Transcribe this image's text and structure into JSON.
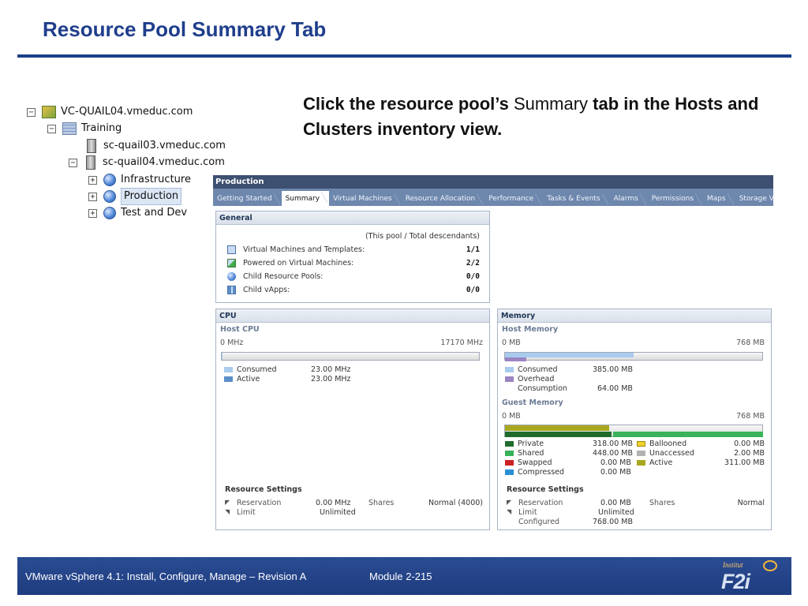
{
  "slide": {
    "title": "Resource Pool Summary Tab",
    "instruction": {
      "part1": "Click the resource pool’s ",
      "part2": "Summary",
      "part3": " tab in the Hosts and Clusters inventory view."
    },
    "footer": {
      "course": "VMware vSphere 4.1: Install, Configure, Manage – Revision A",
      "module": "Module 2-215"
    },
    "logo": {
      "small_text": "Institut",
      "big_text": "F2i"
    }
  },
  "tree": {
    "items": [
      {
        "label": "VC-QUAIL04.vmeduc.com",
        "expander": "−",
        "icon": "vcenter-icon"
      },
      {
        "label": "Training",
        "expander": "−",
        "icon": "datacenter-icon"
      },
      {
        "label": "sc-quail03.vmeduc.com",
        "expander": "",
        "icon": "host-icon"
      },
      {
        "label": "sc-quail04.vmeduc.com",
        "expander": "−",
        "icon": "host-icon"
      },
      {
        "label": "Infrastructure",
        "expander": "+",
        "icon": "resource-pool-icon"
      },
      {
        "label": "Production",
        "expander": "+",
        "icon": "resource-pool-icon",
        "selected": true
      },
      {
        "label": "Test and Dev",
        "expander": "+",
        "icon": "resource-pool-icon"
      }
    ]
  },
  "panel": {
    "title": "Production",
    "tabs": [
      "Getting Started",
      "Summary",
      "Virtual Machines",
      "Resource Allocation",
      "Performance",
      "Tasks & Events",
      "Alarms",
      "Permissions",
      "Maps",
      "Storage Views"
    ],
    "active_tab": "Summary",
    "general": {
      "heading": "General",
      "note": "(This pool / Total descendants)",
      "rows": [
        {
          "label": "Virtual Machines and Templates:",
          "value": "1/1",
          "icon": "vm-template-icon"
        },
        {
          "label": "Powered on Virtual Machines:",
          "value": "2/2",
          "icon": "powered-on-vm-icon"
        },
        {
          "label": "Child Resource Pools:",
          "value": "0/0",
          "icon": "resource-pool-icon"
        },
        {
          "label": "Child vApps:",
          "value": "0/0",
          "icon": "vapp-icon"
        }
      ]
    },
    "cpu": {
      "heading": "CPU",
      "subheading": "Host CPU",
      "min_label": "0 MHz",
      "max_label": "17170 MHz",
      "consumed_fraction": 0.0013,
      "legend": [
        {
          "label": "Consumed",
          "value": "23.00 MHz",
          "color": "#a9cbee"
        },
        {
          "label": "Active",
          "value": "23.00 MHz",
          "color": "#5b8fc9"
        }
      ],
      "settings": {
        "heading": "Resource Settings",
        "reservation_label": "Reservation",
        "reservation_value": "0.00 MHz",
        "limit_label": "Limit",
        "limit_value": "Unlimited",
        "shares_label": "Shares",
        "shares_value": "Normal (4000)"
      }
    },
    "memory": {
      "heading": "Memory",
      "host_subheading": "Host Memory",
      "host_min": "0 MB",
      "host_max": "768 MB",
      "host_consumed_fraction": 0.5,
      "host_overhead_fraction": 0.083,
      "host_legend": [
        {
          "label": "Consumed",
          "value": "385.00 MB",
          "color": "#a9cbee"
        },
        {
          "label": "Overhead",
          "value": "",
          "color": "#9b84c2"
        },
        {
          "label": "Consumption",
          "value": "64.00 MB",
          "color": ""
        }
      ],
      "guest_subheading": "Guest Memory",
      "guest_min": "0 MB",
      "guest_max": "768 MB",
      "guest_active_fraction": 0.405,
      "guest_private_fraction": 0.414,
      "guest_shared_fraction": 0.583,
      "guest_legend_left": [
        {
          "label": "Private",
          "value": "318.00 MB",
          "color": "#1f6b2c"
        },
        {
          "label": "Shared",
          "value": "448.00 MB",
          "color": "#39b25a"
        },
        {
          "label": "Swapped",
          "value": "0.00 MB",
          "color": "#cc2222"
        },
        {
          "label": "Compressed",
          "value": "0.00 MB",
          "color": "#2a8fd6"
        }
      ],
      "guest_legend_right": [
        {
          "label": "Ballooned",
          "value": "0.00 MB",
          "color": "#f0d22a"
        },
        {
          "label": "Unaccessed",
          "value": "2.00 MB",
          "color": "#b2b2b2"
        },
        {
          "label": "Active",
          "value": "311.00 MB",
          "color": "#a8a820"
        }
      ],
      "settings": {
        "heading": "Resource Settings",
        "reservation_label": "Reservation",
        "reservation_value": "0.00 MB",
        "limit_label": "Limit",
        "limit_value": "Unlimited",
        "configured_label": "Configured",
        "configured_value": "768.00 MB",
        "shares_label": "Shares",
        "shares_value": "Normal"
      }
    }
  }
}
